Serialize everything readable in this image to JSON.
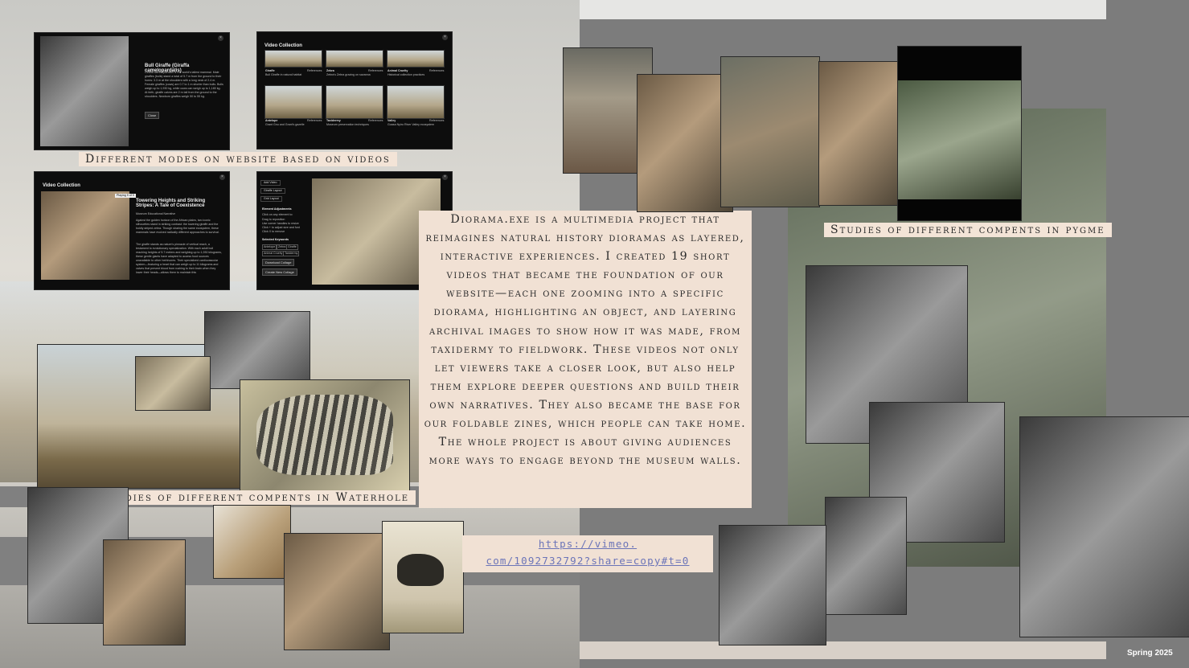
{
  "labels": {
    "modes": "Different modes on website based on videos",
    "pygme": "Studies of different compents in pygme",
    "waterhole": "Studies of different compents in Waterhole"
  },
  "description": "Diorama.exe is a multimedia project that reimagines natural history dioramas as layered, interactive experiences. I created 19 short videos that became the foundation of our website—each one zooming into a specific diorama, highlighting an object, and layering archival images to show how it was made, from taxidermy to fieldwork. These videos not only let viewers take a closer look, but also help them explore deeper questions and build their own narratives. They also became the base for our foldable zines, which people can take home. The whole project is about giving audiences more ways to engage beyond the museum walls.",
  "link": {
    "line1": "https://vimeo.",
    "line2": "com/1092732792?share=copy#t=0"
  },
  "footer": "Spring 2025",
  "screens": {
    "giraffe": {
      "title": "Bull Giraffe (Giraffa camelopardalis)",
      "body": "Giraffa camelopardalis is the world's tallest mammal. Male giraffes (bulls) stand a total of 5.7 m from the ground to their horns: 3.3 m at the shoulders with a long neck of 2.4 m. Female giraffes (cows) are 0.7 to 1 m shorter than bulls. Bulls weigh up to 1,930 kg, while cows can weigh up to 1,180 kg. At birth, giraffe calves are 2 m tall from the ground to the shoulders. Newborn giraffes weigh 50 to 55 kg.",
      "close": "Close"
    },
    "collection": {
      "title": "Video Collection",
      "items": [
        {
          "name": "Giraffe",
          "sub": "Bull Giraffe in natural habitat",
          "tag": "References"
        },
        {
          "name": "Zebra",
          "sub": "Zebra's Zebra grazing on savanna",
          "tag": "References"
        },
        {
          "name": "Animal Cruelty",
          "sub": "Historical collection practices",
          "tag": "References"
        },
        {
          "name": "Antelope",
          "sub": "Grant Gnu and Grant's gazelle",
          "tag": "References"
        },
        {
          "name": "Taxidermy",
          "sub": "Museum preservation techniques",
          "tag": "References"
        },
        {
          "name": "Valley",
          "sub": "Guasa Nyiro River Valley ecosystem",
          "tag": "References"
        }
      ]
    },
    "story": {
      "title": "Video Collection",
      "badge": "Playing 9 of 9",
      "heading": "Towering Heights and Striking Stripes: A Tale of Coexistence",
      "meta": "Museum Educational Narrative",
      "body1": "Against the golden horizon of the African plains, two iconic silhouettes stand in striking contrast: the towering giraffe and the boldly striped zebra. Though sharing the same ecosystem, these mammals have evolved radically different approaches to survival.",
      "body2": "The giraffe stands as nature's pinnacle of vertical reach, a testament to evolutionary specialization. With each adult bull reaching heights of 5.7 meters and weighing up to 1,930 kilograms, these gentle giants have adapted to access food sources unavailable to other herbivores. Their specialized cardiovascular system—featuring a heart that can weigh up to 11 kilograms and valves that prevent blood from rushing to their brain when they lower their heads—allows them to maintain this"
    },
    "editor": {
      "menu": [
        "Add Video",
        "Giraffe Layout",
        "Grid Layout"
      ],
      "adjust_title": "Element Adjustments",
      "adjust_items": [
        "Click on any element to:",
        "Drag to reposition",
        "Use corner handles to resize",
        "Click + to adjust size and font",
        "Click X to remove"
      ],
      "keywords_title": "Selected Keywords",
      "keywords": [
        "Antelope",
        "Zebra",
        "Giraffe",
        "Animal Cruelty",
        "Taxidermy"
      ],
      "download": "Download Collage",
      "create": "Create New Collage"
    }
  }
}
